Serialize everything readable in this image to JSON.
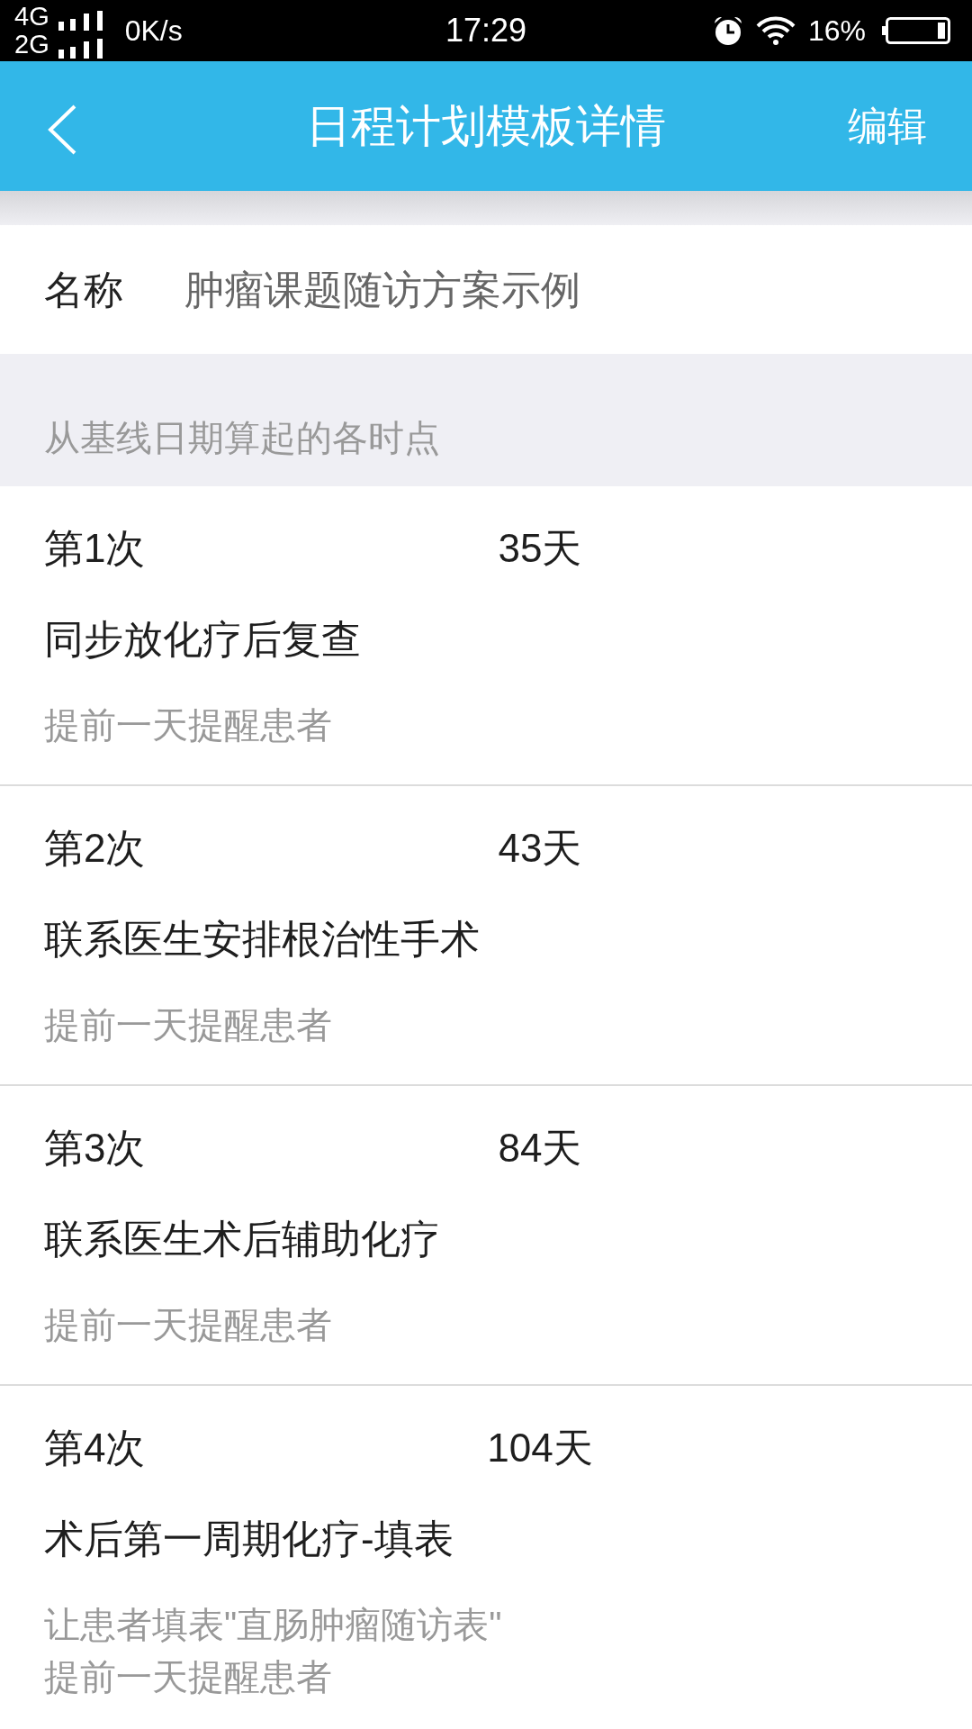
{
  "status_bar": {
    "network_top": "4G",
    "network_bottom": "2G",
    "speed": "0K/s",
    "time": "17:29",
    "battery": "16%"
  },
  "header": {
    "title": "日程计划模板详情",
    "action": "编辑"
  },
  "name_field": {
    "label": "名称",
    "value": "肿瘤课题随访方案示例"
  },
  "section": {
    "title": "从基线日期算起的各时点"
  },
  "visits": [
    {
      "label": "第1次",
      "days": "35天",
      "title": "同步放化疗后复查",
      "notes": [
        "提前一天提醒患者"
      ]
    },
    {
      "label": "第2次",
      "days": "43天",
      "title": "联系医生安排根治性手术",
      "notes": [
        "提前一天提醒患者"
      ]
    },
    {
      "label": "第3次",
      "days": "84天",
      "title": "联系医生术后辅助化疗",
      "notes": [
        "提前一天提醒患者"
      ]
    },
    {
      "label": "第4次",
      "days": "104天",
      "title": "术后第一周期化疗-填表",
      "notes": [
        "让患者填表\"直肠肿瘤随访表\"",
        "提前一天提醒患者"
      ]
    }
  ]
}
